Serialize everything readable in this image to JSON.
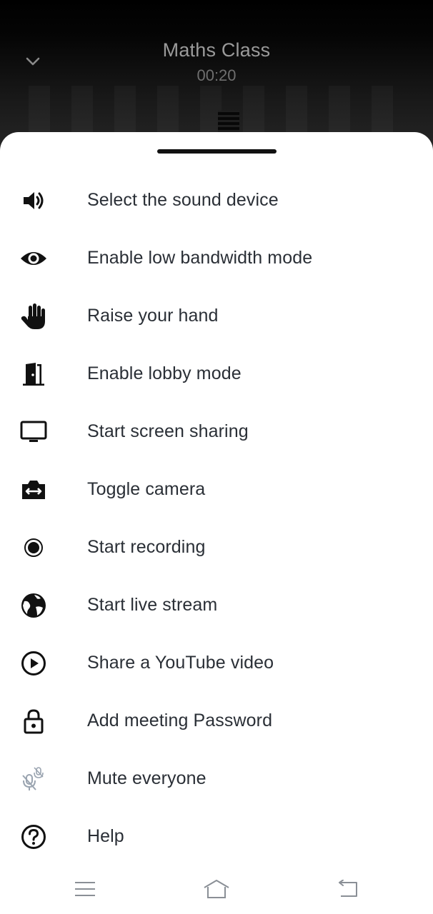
{
  "call": {
    "title": "Maths Class",
    "timer": "00:20",
    "collapse_icon": "chevron-down-icon"
  },
  "menu": {
    "items": [
      {
        "label": "Select the sound device",
        "icon": "speaker-icon"
      },
      {
        "label": "Enable low bandwidth mode",
        "icon": "eye-icon"
      },
      {
        "label": "Raise your hand",
        "icon": "hand-icon"
      },
      {
        "label": "Enable lobby mode",
        "icon": "door-icon"
      },
      {
        "label": "Start screen sharing",
        "icon": "monitor-icon"
      },
      {
        "label": "Toggle camera",
        "icon": "camera-switch-icon"
      },
      {
        "label": "Start recording",
        "icon": "record-icon"
      },
      {
        "label": "Start live stream",
        "icon": "globe-icon"
      },
      {
        "label": "Share a YouTube video",
        "icon": "play-circle-icon"
      },
      {
        "label": "Add meeting Password",
        "icon": "lock-icon"
      },
      {
        "label": "Mute everyone",
        "icon": "mic-off-icon"
      },
      {
        "label": "Help",
        "icon": "help-circle-icon"
      }
    ]
  },
  "nav": {
    "menu_icon": "menu-icon",
    "home_icon": "home-icon",
    "back_icon": "back-icon"
  },
  "colors": {
    "text": "#2a2f36",
    "icon": "#111111",
    "disabled_icon": "#9aa4b0",
    "title": "#9a9a9a"
  }
}
